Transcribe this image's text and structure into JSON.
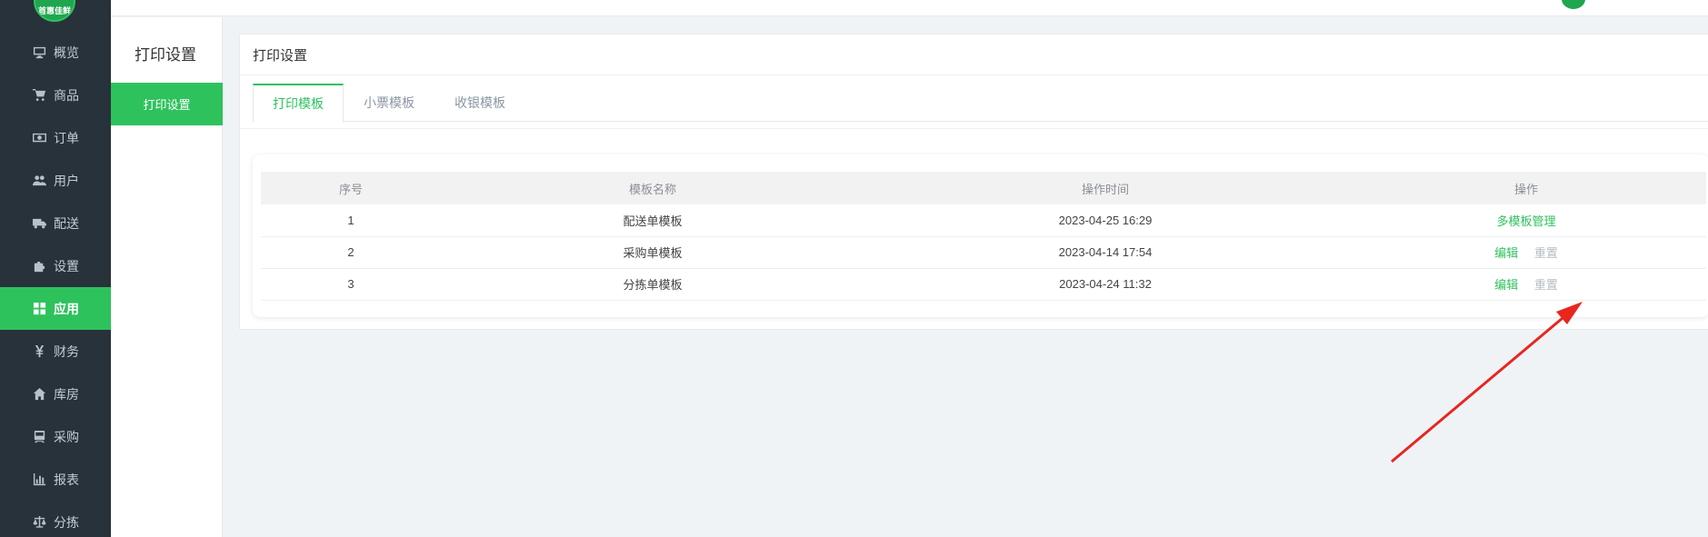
{
  "sidebar": {
    "logo_text": "首惠佳鲜",
    "items": [
      {
        "label": "概览",
        "icon": "monitor-icon"
      },
      {
        "label": "商品",
        "icon": "cart-icon"
      },
      {
        "label": "订单",
        "icon": "money-icon"
      },
      {
        "label": "用户",
        "icon": "users-icon"
      },
      {
        "label": "配送",
        "icon": "truck-icon"
      },
      {
        "label": "设置",
        "icon": "puzzle-icon"
      },
      {
        "label": "应用",
        "icon": "apps-icon",
        "active": true
      },
      {
        "label": "财务",
        "icon": "yen-icon"
      },
      {
        "label": "库房",
        "icon": "home-icon"
      },
      {
        "label": "采购",
        "icon": "train-icon"
      },
      {
        "label": "报表",
        "icon": "bar-chart-icon"
      },
      {
        "label": "分拣",
        "icon": "scale-icon"
      }
    ]
  },
  "subnav": {
    "title": "打印设置",
    "item": "打印设置"
  },
  "main": {
    "title": "打印设置",
    "tabs": [
      {
        "label": "打印模板",
        "active": true
      },
      {
        "label": "小票模板"
      },
      {
        "label": "收银模板"
      }
    ],
    "table": {
      "headers": [
        "序号",
        "模板名称",
        "操作时间",
        "操作"
      ],
      "rows": [
        {
          "index": "1",
          "name": "配送单模板",
          "time": "2023-04-25 16:29",
          "action_primary": "多模板管理",
          "action_secondary": ""
        },
        {
          "index": "2",
          "name": "采购单模板",
          "time": "2023-04-14 17:54",
          "action_primary": "编辑",
          "action_secondary": "重置"
        },
        {
          "index": "3",
          "name": "分拣单模板",
          "time": "2023-04-24 11:32",
          "action_primary": "编辑",
          "action_secondary": "重置"
        }
      ]
    }
  },
  "colors": {
    "accent": "#2ec25d",
    "sidebar_bg": "#28323b",
    "annotation_arrow": "#e8261e"
  }
}
